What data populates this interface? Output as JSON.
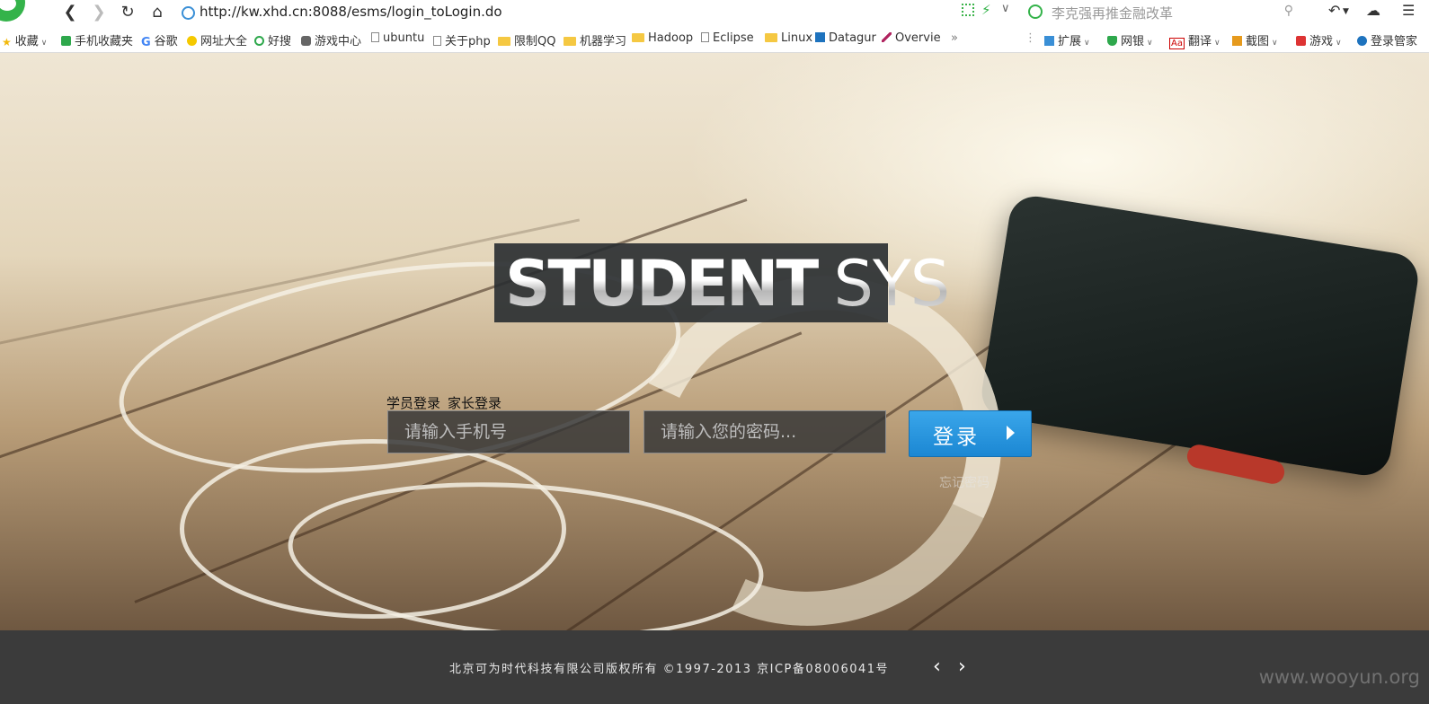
{
  "browser": {
    "url": "http://kw.xhd.cn:8088/esms/login_toLogin.do",
    "search_placeholder": "李克强再推金融改革",
    "bookmarks": [
      "收藏",
      "手机收藏夹",
      "谷歌",
      "网址大全",
      "好搜",
      "游戏中心",
      "ubuntu",
      "关于php",
      "限制QQ",
      "机器学习",
      "Hadoop",
      "Eclipse",
      "Linux",
      "Datagur",
      "Overvie"
    ],
    "more": "»",
    "tools": [
      "扩展",
      "网银",
      "翻译",
      "截图",
      "游戏",
      "登录管家"
    ]
  },
  "page": {
    "logo_left": "STUDENT",
    "logo_right": "SYS",
    "tab_student": "学员登录",
    "tab_parent": "家长登录",
    "phone_placeholder": "请输入手机号",
    "password_placeholder": "请输入您的密码...",
    "login_button": "登录",
    "forgot": "忘记密码"
  },
  "footer": {
    "copyright": "北京可为时代科技有限公司版权所有  ©1997-2013  京ICP备08006041号",
    "watermark": "www.wooyun.org"
  },
  "colors": {
    "login_button": "#1b87d3",
    "footer_bg": "#3b3b3b"
  }
}
